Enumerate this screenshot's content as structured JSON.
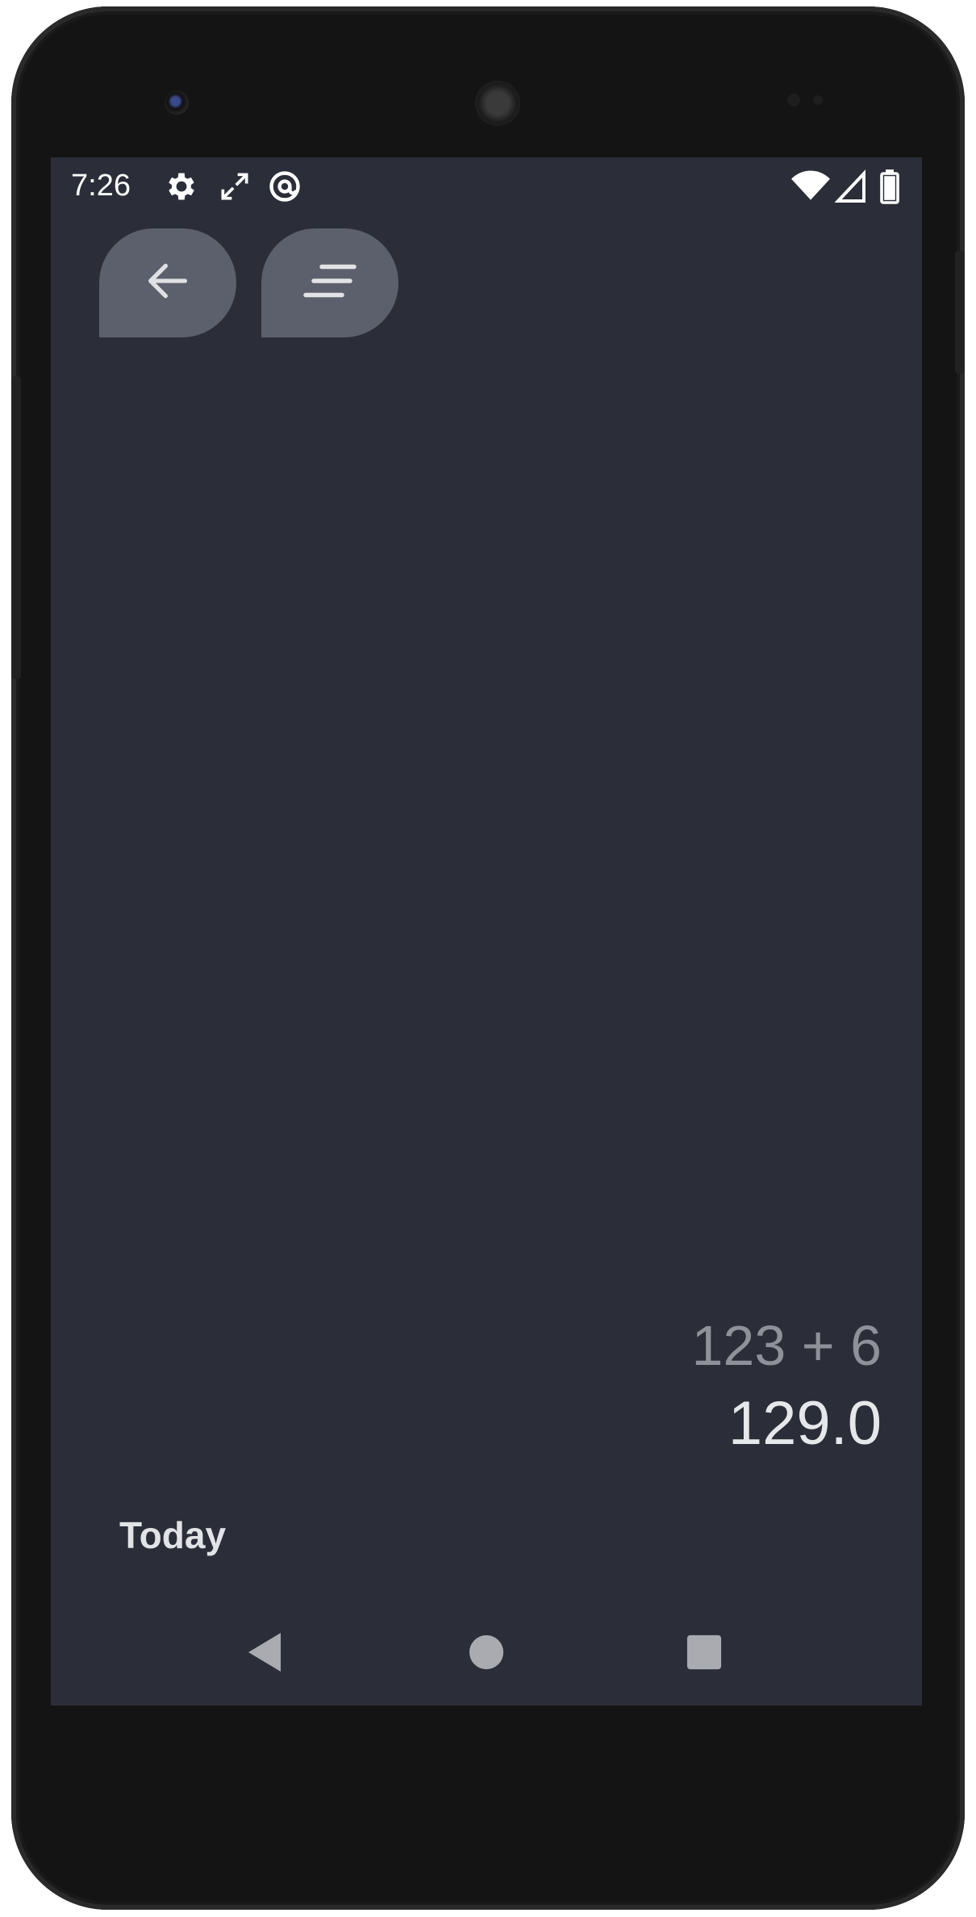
{
  "status_bar": {
    "time": "7:26",
    "left_icons": [
      "gear-icon",
      "expand-arrows-icon",
      "at-sign-icon"
    ],
    "right_icons": [
      "wifi-icon",
      "cellular-signal-icon",
      "battery-icon"
    ]
  },
  "toolbar": {
    "back_icon": "arrow-left-icon",
    "menu_icon": "lines-menu-icon"
  },
  "calculator": {
    "expression": "123 + 6",
    "result": "129.0"
  },
  "history": {
    "section_label": "Today"
  },
  "navigation": {
    "icons": [
      "back-triangle-icon",
      "home-circle-icon",
      "recents-square-icon"
    ]
  },
  "colors": {
    "screen_background": "#2b2e38",
    "button_background": "#5b606c",
    "expression_text": "#8e919a",
    "result_text": "#e6e7ea",
    "nav_icon": "#a9abb1"
  }
}
